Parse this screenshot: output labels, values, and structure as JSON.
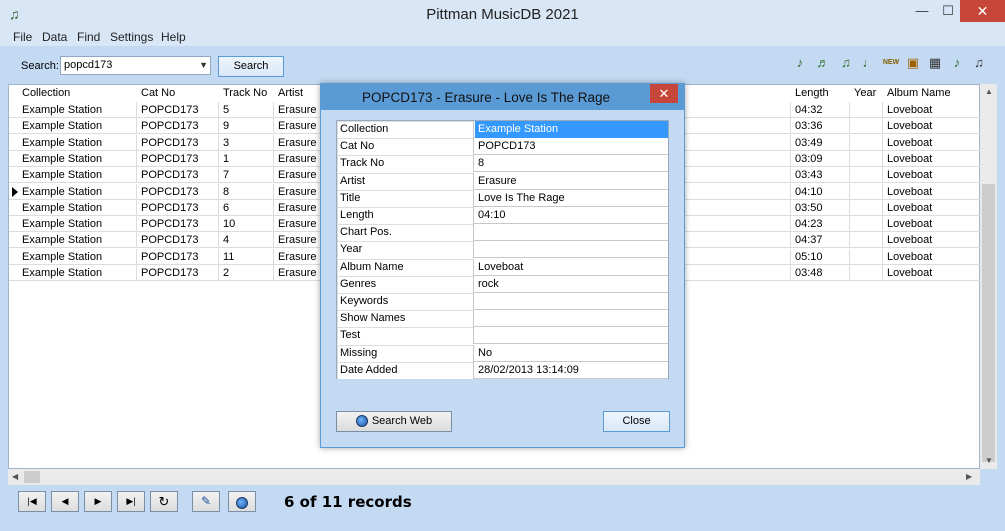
{
  "window": {
    "title": "Pittman MusicDB 2021",
    "min": "—",
    "max": "☐",
    "close": "✕"
  },
  "menu": [
    "File",
    "Data",
    "Find",
    "Settings",
    "Help"
  ],
  "toolbar": {
    "search_label": "Search:",
    "search_value": "popcd173",
    "search_button": "Search",
    "icons": [
      "add-track-icon",
      "import-icon",
      "music-notes-icon",
      "genre-icon",
      "new-icon",
      "folder-music-icon",
      "grid-icon",
      "playlist-icon",
      "music-file-icon"
    ]
  },
  "grid": {
    "columns": [
      "Collection",
      "Cat No",
      "Track No",
      "Artist",
      "Length",
      "Year",
      "Album Name"
    ],
    "rows": [
      {
        "collection": "Example Station",
        "cat_no": "POPCD173",
        "track_no": "5",
        "artist": "Erasure",
        "length": "04:32",
        "year": "",
        "album": "Loveboat"
      },
      {
        "collection": "Example Station",
        "cat_no": "POPCD173",
        "track_no": "9",
        "artist": "Erasure",
        "length": "03:36",
        "year": "",
        "album": "Loveboat"
      },
      {
        "collection": "Example Station",
        "cat_no": "POPCD173",
        "track_no": "3",
        "artist": "Erasure",
        "length": "03:49",
        "year": "",
        "album": "Loveboat"
      },
      {
        "collection": "Example Station",
        "cat_no": "POPCD173",
        "track_no": "1",
        "artist": "Erasure",
        "length": "03:09",
        "year": "",
        "album": "Loveboat"
      },
      {
        "collection": "Example Station",
        "cat_no": "POPCD173",
        "track_no": "7",
        "artist": "Erasure",
        "length": "03:43",
        "year": "",
        "album": "Loveboat"
      },
      {
        "collection": "Example Station",
        "cat_no": "POPCD173",
        "track_no": "8",
        "artist": "Erasure",
        "length": "04:10",
        "year": "",
        "album": "Loveboat"
      },
      {
        "collection": "Example Station",
        "cat_no": "POPCD173",
        "track_no": "6",
        "artist": "Erasure",
        "length": "03:50",
        "year": "",
        "album": "Loveboat"
      },
      {
        "collection": "Example Station",
        "cat_no": "POPCD173",
        "track_no": "10",
        "artist": "Erasure",
        "length": "04:23",
        "year": "",
        "album": "Loveboat"
      },
      {
        "collection": "Example Station",
        "cat_no": "POPCD173",
        "track_no": "4",
        "artist": "Erasure",
        "length": "04:37",
        "year": "",
        "album": "Loveboat"
      },
      {
        "collection": "Example Station",
        "cat_no": "POPCD173",
        "track_no": "11",
        "artist": "Erasure",
        "length": "05:10",
        "year": "",
        "album": "Loveboat"
      },
      {
        "collection": "Example Station",
        "cat_no": "POPCD173",
        "track_no": "2",
        "artist": "Erasure",
        "length": "03:48",
        "year": "",
        "album": "Loveboat"
      }
    ]
  },
  "dialog": {
    "title": "POPCD173 - Erasure - Love Is The Rage",
    "fields": [
      {
        "label": "Collection",
        "value": "Example Station"
      },
      {
        "label": "Cat No",
        "value": "POPCD173"
      },
      {
        "label": "Track No",
        "value": "8"
      },
      {
        "label": "Artist",
        "value": "Erasure"
      },
      {
        "label": "Title",
        "value": "Love Is The Rage"
      },
      {
        "label": "Length",
        "value": "04:10"
      },
      {
        "label": "Chart Pos.",
        "value": ""
      },
      {
        "label": "Year",
        "value": ""
      },
      {
        "label": "Album Name",
        "value": "Loveboat"
      },
      {
        "label": "Genres",
        "value": "rock"
      },
      {
        "label": "Keywords",
        "value": ""
      },
      {
        "label": "Show Names",
        "value": ""
      },
      {
        "label": "Test",
        "value": ""
      },
      {
        "label": "Missing",
        "value": "No"
      },
      {
        "label": "Date Added",
        "value": "28/02/2013 13:14:09"
      }
    ],
    "search_web_button": "Search Web",
    "close_button": "Close"
  },
  "navigation": {
    "buttons": [
      "first-record",
      "previous-record",
      "next-record",
      "last-record",
      "refresh",
      "edit",
      "web"
    ],
    "status": "6 of 11 records"
  },
  "colors": {
    "background": "#c4daf2",
    "dialog_title": "#5b9bd5",
    "selection": "#3399ff",
    "close": "#c7463a"
  }
}
